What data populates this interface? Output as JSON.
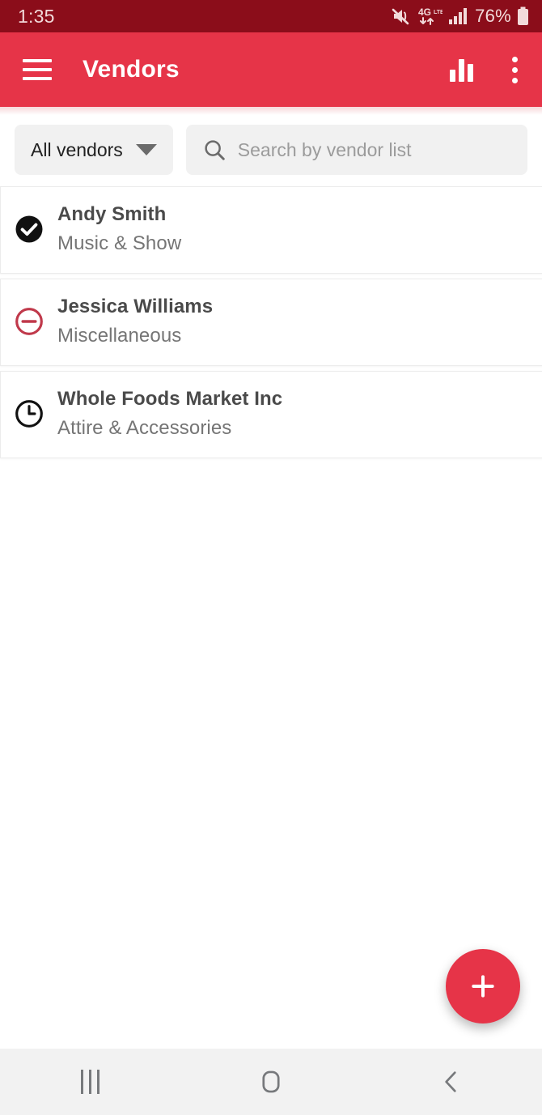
{
  "status_bar": {
    "time": "1:35",
    "battery_percent": "76%",
    "icons": [
      "mute-icon",
      "4g-lte-data-icon",
      "signal-bars-icon",
      "battery-icon"
    ],
    "background_color": "#8B0D1A"
  },
  "app_bar": {
    "title": "Vendors",
    "menu_icon": "hamburger-icon",
    "actions": [
      "bar-chart-icon",
      "overflow-menu-icon"
    ],
    "background_color": "#E63448"
  },
  "filter": {
    "vendor_filter_label": "All vendors",
    "dropdown_icon": "chevron-down-icon",
    "search_icon": "search-icon",
    "search_value": "",
    "search_placeholder": "Search by vendor list"
  },
  "vendors": [
    {
      "name": "Andy Smith",
      "category": "Music & Show",
      "status_icon": "check-circle-filled-icon",
      "status_color": "#111111"
    },
    {
      "name": "Jessica Williams",
      "category": "Miscellaneous",
      "status_icon": "minus-circle-outline-icon",
      "status_color": "#C0394B"
    },
    {
      "name": "Whole Foods Market Inc",
      "category": "Attire & Accessories",
      "status_icon": "clock-outline-icon",
      "status_color": "#111111"
    }
  ],
  "fab": {
    "icon": "plus-icon",
    "color": "#E63448"
  },
  "nav_bar": {
    "recents_icon": "recents-icon",
    "home_icon": "home-icon",
    "back_icon": "back-chevron-icon",
    "background_color": "#F2F2F2"
  }
}
